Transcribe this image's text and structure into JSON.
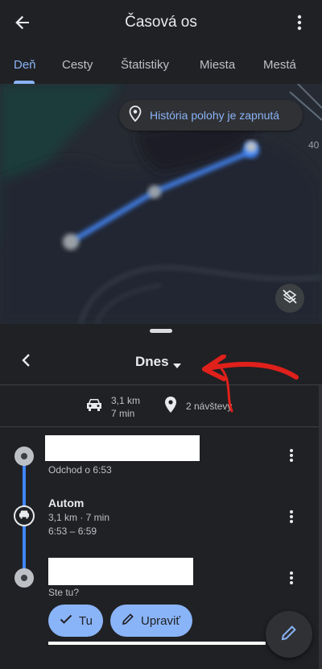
{
  "app_bar": {
    "title": "Časová os",
    "back_icon": "arrow-back-icon",
    "more_icon": "more-vert-icon"
  },
  "tabs": [
    {
      "label": "Deň",
      "active": true
    },
    {
      "label": "Cesty",
      "active": false
    },
    {
      "label": "Štatistiky",
      "active": false
    },
    {
      "label": "Miesta",
      "active": false
    },
    {
      "label": "Mestá",
      "active": false
    }
  ],
  "map": {
    "location_history_chip": "História polohy je zapnutá",
    "edge_label": "40",
    "layer_icon": "layers-off-icon"
  },
  "day_navigator": {
    "day_label": "Dnes"
  },
  "summary": {
    "distance": "3,1 km",
    "duration": "7 min",
    "visits": "2 návštevy"
  },
  "timeline": {
    "stop1": {
      "subtitle": "Odchod o 6:53"
    },
    "segment": {
      "title": "Autom",
      "details": "3,1 km · 7 min",
      "time_range": "6:53 – 6:59"
    },
    "stop2": {
      "subtitle": "Ste tu?"
    }
  },
  "actions": {
    "confirm_label": "Tu",
    "edit_label": "Upraviť"
  },
  "colors": {
    "accent": "#8ab4f8",
    "route": "#4285f4",
    "background": "#202124",
    "annotation_arrow": "#e0201b"
  }
}
